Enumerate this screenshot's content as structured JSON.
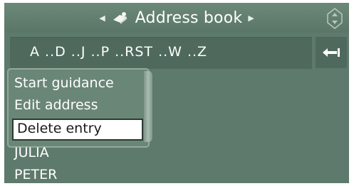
{
  "header": {
    "title": "Address book",
    "left_arrow_icon": "triangle-left",
    "right_arrow_icon": "triangle-right",
    "book_icon": "address-book-icon",
    "controller_icon": "controller-icon"
  },
  "alphabet_bar": {
    "text": "A ..D ..J ..P ..RST ..W ..Z",
    "back_icon": "back-arrow-icon"
  },
  "menu": {
    "items": [
      {
        "label": "Start guidance"
      },
      {
        "label": "Edit address"
      },
      {
        "label": "Delete entry",
        "selected": true
      }
    ]
  },
  "contacts": [
    {
      "name": "JULIA"
    },
    {
      "name": "PETER"
    }
  ],
  "colors": {
    "screen_bg": "#5e7a6c",
    "bar_bg": "#4f6a5c",
    "selected_bg": "#ffffff",
    "text": "#ffffff"
  }
}
